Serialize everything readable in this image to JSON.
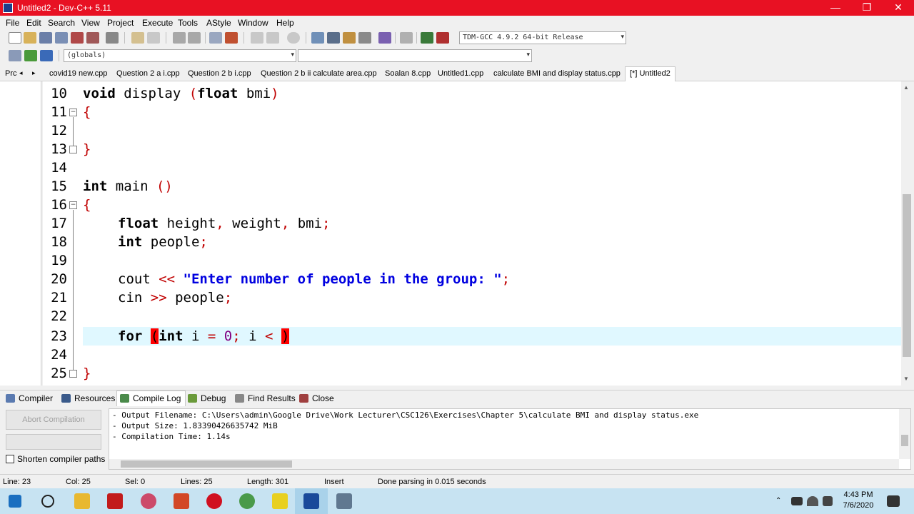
{
  "window": {
    "title": "Untitled2 - Dev-C++ 5.11",
    "minimize_glyph": "—",
    "restore_glyph": "❐",
    "close_glyph": "✕"
  },
  "menu": [
    "File",
    "Edit",
    "Search",
    "View",
    "Project",
    "Execute",
    "Tools",
    "AStyle",
    "Window",
    "Help"
  ],
  "toolbar": {
    "compiler_select": "TDM-GCC 4.9.2 64-bit Release",
    "scope_select": "(globals)",
    "member_select": ""
  },
  "tabs": {
    "left_label": "Prc",
    "files": [
      "covid19 new.cpp",
      "Question 2 a i.cpp",
      "Question 2 b i.cpp",
      "Question 2 b ii calculate area.cpp",
      "Soalan 8.cpp",
      "Untitled1.cpp",
      "calculate BMI and display status.cpp"
    ],
    "active": "[*] Untitled2"
  },
  "editor": {
    "line_numbers": [
      "10",
      "11",
      "12",
      "13",
      "14",
      "15",
      "16",
      "17",
      "18",
      "19",
      "20",
      "21",
      "22",
      "23",
      "24",
      "25"
    ],
    "lines": {
      "l10_kw": "void",
      "l10_rest": " display ",
      "l10_p1": "(",
      "l10_kw2": "float",
      "l10_var": " bmi",
      "l10_p2": ")",
      "l11": "{",
      "l13": "}",
      "l15_kw": "int",
      "l15_rest": " main ",
      "l15_p": "()",
      "l16": "{",
      "l17_kw": "float",
      "l17_a": " height",
      "l17_c1": ",",
      "l17_b": " weight",
      "l17_c2": ",",
      "l17_c": " bmi",
      "l17_semi": ";",
      "l18_kw": "int",
      "l18_a": " people",
      "l18_semi": ";",
      "l20_a": "cout ",
      "l20_op": "<<",
      "l20_str": " \"Enter number of people in the group: \"",
      "l20_semi": ";",
      "l21_a": "cin ",
      "l21_op": ">>",
      "l21_b": " people",
      "l21_semi": ";",
      "l23_kw": "for",
      "l23_sp": " ",
      "l23_p1": "(",
      "l23_kw2": "int",
      "l23_a": " i ",
      "l23_eq": "=",
      "l23_sp2": " ",
      "l23_num": "0",
      "l23_semi": ";",
      "l23_b": " i ",
      "l23_lt": "<",
      "l23_sp3": " ",
      "l23_p2": ")",
      "l25": "}"
    }
  },
  "bottom_tabs": [
    "Compiler",
    "Resources",
    "Compile Log",
    "Debug",
    "Find Results",
    "Close"
  ],
  "compile_panel": {
    "abort_label": "Abort Compilation",
    "shorten_label": "Shorten compiler paths",
    "log": [
      "- Output Filename: C:\\Users\\admin\\Google Drive\\Work Lecturer\\CSC126\\Exercises\\Chapter 5\\calculate BMI and display status.exe",
      "- Output Size: 1.83390426635742 MiB",
      "- Compilation Time: 1.14s"
    ]
  },
  "status": {
    "line": "Line:    23",
    "col": "Col:    25",
    "sel": "Sel:    0",
    "lines": "Lines:    25",
    "length": "Length:    301",
    "mode": "Insert",
    "message": "Done parsing in 0.015 seconds"
  },
  "taskbar": {
    "time": "4:43 PM",
    "date": "7/6/2020"
  },
  "colors": {
    "titlebar": "#e81123",
    "current_line": "#e0f8ff",
    "string": "#0000e0",
    "symbol": "#c00000",
    "number": "#800080"
  }
}
